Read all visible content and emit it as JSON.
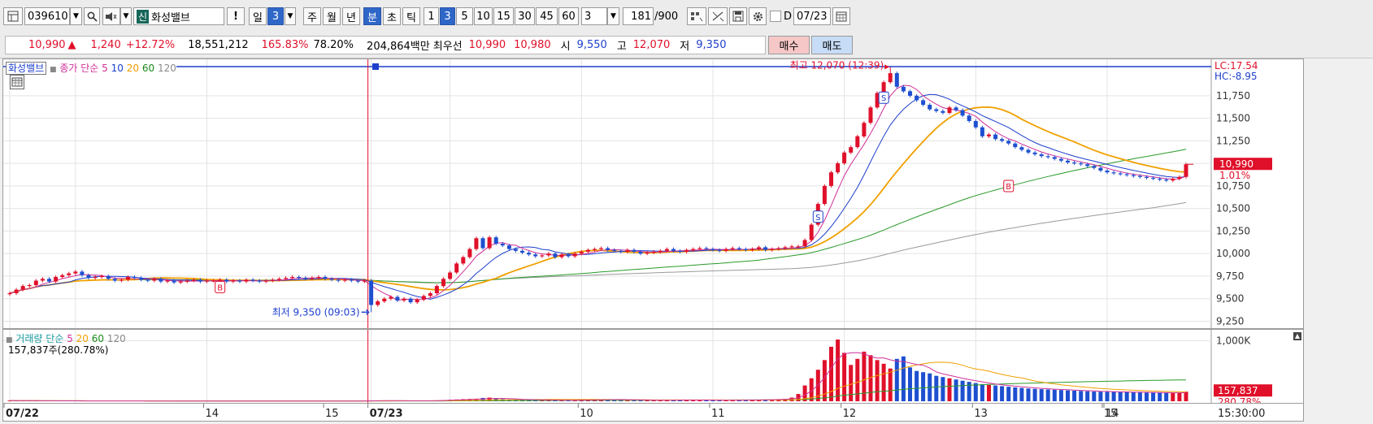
{
  "toolbar": {
    "stock_code": "039610",
    "stock_badge": "신",
    "stock_name": "화성밸브",
    "alert_label": "!",
    "period_day": "일",
    "period_day_count": "3",
    "period_week": "주",
    "period_month": "월",
    "period_year": "년",
    "period_minute": "분",
    "period_second": "초",
    "period_tick": "틱",
    "intervals": [
      "1",
      "3",
      "5",
      "10",
      "15",
      "30",
      "45",
      "60"
    ],
    "selected_interval": "3",
    "interval_count": "3",
    "data_count": "181",
    "data_total": "/900",
    "date_prefix": "D",
    "date_value": "07/23"
  },
  "quote": {
    "price": "10,990",
    "change_arrow": "▲",
    "change": "1,240",
    "change_pct": "+12.72%",
    "volume": "18,551,212",
    "volume_ratio": "165.83%",
    "turnover_ratio": "78.20%",
    "amount": "204,864백만",
    "best_label": "최우선",
    "best_ask": "10,990",
    "best_bid": "10,980",
    "open_label": "시",
    "open": "9,550",
    "high_label": "고",
    "high": "12,070",
    "low_label": "저",
    "low": "9,350",
    "buy_label": "매수",
    "sell_label": "매도"
  },
  "price_chart": {
    "stock_title": "화성밸브",
    "legend_prefix": "종가 단순",
    "ma_periods": [
      "5",
      "10",
      "20",
      "60",
      "120"
    ],
    "high_annotation": "최고 12,070 (12:39)",
    "low_annotation": "최저 9,350 (09:03)",
    "lc_label": "LC:17.54",
    "hc_label": "HC:-8.95",
    "current_price_label": "10,990",
    "current_pct_label": "1.01%",
    "y_labels": [
      "11,750",
      "11,500",
      "11,250",
      "11,000",
      "10,750",
      "10,500",
      "10,250",
      "10,000",
      "9,750",
      "9,500",
      "9,250"
    ]
  },
  "volume_chart": {
    "legend_prefix": "거래량 단순",
    "ma_periods": [
      "5",
      "20",
      "60",
      "120"
    ],
    "current_summary": "157,837주(280.78%)",
    "y_label": "1,000K",
    "current_volume_label": "157,837",
    "current_pct_label": "280.78%"
  },
  "time_axis": {
    "labels": [
      "07/22",
      "14",
      "15",
      "07/23",
      "10",
      "11",
      "12",
      "13",
      "14",
      "15"
    ],
    "current_time": "15:30:00"
  },
  "chart_data": {
    "type": "candlestick",
    "x_unit": "3-minute bars",
    "ylim": [
      9200,
      12100
    ],
    "session_1_date": "07/22",
    "session_2_date": "07/23",
    "day_open": 9550,
    "day_high": 12070,
    "day_high_time": "12:39",
    "day_low": 9350,
    "day_low_time": "09:03",
    "last_price": 10990,
    "series_close": [
      9560,
      9600,
      9640,
      9650,
      9700,
      9720,
      9690,
      9740,
      9760,
      9780,
      9800,
      9760,
      9730,
      9740,
      9750,
      9720,
      9700,
      9710,
      9740,
      9730,
      9710,
      9700,
      9720,
      9690,
      9700,
      9680,
      9690,
      9700,
      9710,
      9690,
      9700,
      9700,
      9710,
      9690,
      9700,
      9690,
      9710,
      9700,
      9690,
      9700,
      9710,
      9720,
      9730,
      9740,
      9730,
      9720,
      9730,
      9740,
      9720,
      9710,
      9700,
      9710,
      9700,
      9690,
      9700,
      9430,
      9470,
      9500,
      9520,
      9480,
      9500,
      9460,
      9490,
      9530,
      9560,
      9640,
      9720,
      9790,
      9890,
      9960,
      10050,
      10170,
      10060,
      10180,
      10110,
      10090,
      10050,
      10030,
      10010,
      9990,
      9970,
      9980,
      10000,
      9960,
      9990,
      9970,
      10000,
      10020,
      10040,
      10050,
      10060,
      10040,
      10030,
      10020,
      10040,
      10020,
      10000,
      10010,
      10020,
      10030,
      10050,
      10030,
      10020,
      10040,
      10050,
      10060,
      10050,
      10040,
      10030,
      10050,
      10060,
      10050,
      10040,
      10050,
      10070,
      10040,
      10050,
      10060,
      10070,
      10080,
      10080,
      10150,
      10320,
      10550,
      10750,
      10900,
      11000,
      11120,
      11180,
      11300,
      11450,
      11620,
      11780,
      11900,
      12000,
      11850,
      11800,
      11750,
      11700,
      11650,
      11600,
      11580,
      11560,
      11620,
      11590,
      11530,
      11470,
      11400,
      11300,
      11320,
      11270,
      11250,
      11220,
      11180,
      11150,
      11120,
      11100,
      11080,
      11070,
      11050,
      11030,
      11010,
      11000,
      10990,
      10970,
      10950,
      10920,
      10900,
      10890,
      10880,
      10870,
      10860,
      10850,
      10840,
      10830,
      10820,
      10810,
      10830,
      10850,
      10990
    ],
    "series_volume": [
      12,
      10,
      8,
      9,
      7,
      6,
      8,
      7,
      6,
      5,
      6,
      5,
      6,
      5,
      4,
      5,
      6,
      5,
      4,
      5,
      5,
      4,
      5,
      4,
      5,
      4,
      5,
      4,
      5,
      4,
      5,
      4,
      5,
      4,
      5,
      4,
      5,
      4,
      5,
      4,
      5,
      4,
      5,
      4,
      5,
      4,
      5,
      4,
      5,
      4,
      5,
      4,
      5,
      4,
      6,
      12,
      14,
      10,
      9,
      8,
      7,
      6,
      8,
      10,
      12,
      14,
      18,
      24,
      30,
      35,
      38,
      42,
      55,
      60,
      40,
      36,
      30,
      28,
      26,
      24,
      22,
      20,
      18,
      17,
      16,
      18,
      20,
      22,
      24,
      26,
      28,
      30,
      28,
      26,
      24,
      20,
      18,
      17,
      16,
      18,
      19,
      20,
      22,
      21,
      20,
      19,
      18,
      17,
      16,
      18,
      19,
      20,
      21,
      22,
      24,
      30,
      32,
      35,
      40,
      60,
      120,
      260,
      380,
      520,
      680,
      900,
      1020,
      800,
      600,
      700,
      820,
      760,
      680,
      620,
      540,
      700,
      740,
      560,
      500,
      480,
      460,
      420,
      400,
      380,
      360,
      340,
      320,
      300,
      280,
      270,
      260,
      250,
      240,
      230,
      220,
      210,
      205,
      200,
      195,
      190,
      185,
      180,
      175,
      170,
      165,
      160,
      158,
      156,
      154,
      152,
      150,
      148,
      146,
      144,
      142,
      140,
      138,
      136,
      140,
      158
    ]
  }
}
